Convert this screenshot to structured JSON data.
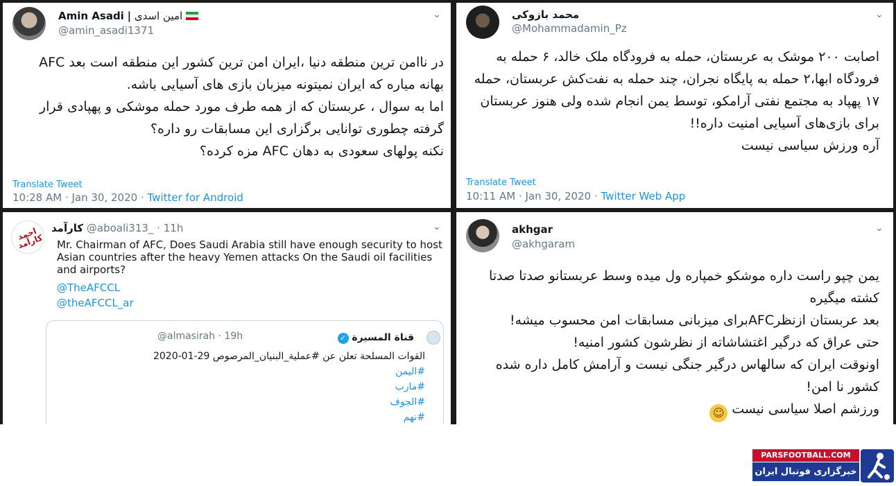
{
  "tweets": [
    {
      "display_name": "Amin Asadi",
      "persian_name": "امین اسدی",
      "handle": "@amin_asadi1371",
      "lines": [
        "در ناامن ترین منطقه دنیا ،ایران امن ترین کشور این منطقه است بعد AFC",
        "بهانه میاره که ایران نمیتونه میزبان بازی های آسیایی باشه.",
        "اما به سوال ، عربستان که از همه طرف مورد حمله موشکی و پهپادی قرار",
        "گرفته چطوری توانایی برگزاری این مسابقات رو داره؟",
        "نکنه پولهای سعودی به دهان AFC مزه کرده؟"
      ],
      "translate": "Translate Tweet",
      "meta": "10:28 AM · Jan 30, 2020 · ",
      "source": "Twitter for Android"
    },
    {
      "display_name": "محمد بازوکی",
      "handle": "@Mohammadamin_Pz",
      "lines": [
        "اصابت ۲۰۰ موشک به عربستان، حمله به فرودگاه ملک خالد، ۶ حمله به",
        "فرودگاه ابها،۲ حمله به پایگاه نجران، چند حمله به نفت‌کش عربستان، حمله",
        "۱۷ پهپاد به مجتمع نفتی آرامکو، توسط یمن انجام شده ولی هنوز عربستان",
        "برای بازی‌های آسیایی امنیت داره!!",
        "آره ورزش سیاسی نیست"
      ],
      "translate": "Translate Tweet",
      "meta": "10:11 AM · Jan 30, 2020 · ",
      "source": "Twitter Web App"
    },
    {
      "display_name": "کارآمد",
      "handle": "@aboali313_ · 11h",
      "avatar_text": "احمد کارآمد",
      "text": "Mr. Chairman of AFC, Does Saudi Arabia still have enough security to host Asian countries after the heavy Yemen attacks On the Saudi oil facilities and airports?",
      "mentions": [
        "@TheAFCCL",
        "@theAFCCL_ar"
      ],
      "quote": {
        "name": "قناة المسيرة",
        "handle": "@almasirah · 19h",
        "lines": [
          "القوات المسلحة تعلن عن #عملية_البنيان_المرصوص 29-01-2020",
          "#اليمن",
          "#مارب",
          "#الجوف",
          "#نهم"
        ]
      }
    },
    {
      "display_name": "akhgar",
      "handle": "@akhgaram",
      "lines": [
        "یمن چپو راست داره موشکو خمپاره ول میده وسط عربستانو صدتا صدتا",
        "کشته میگیره",
        "بعد عربستان ازنظرAFCبرای میزبانی مسابقات امن محسوب میشه!",
        "حتی عراق که درگیر اغتشاشاته از نظرشون کشور امنیه!",
        "اونوقت ایران که سالهاس درگیر جنگی نیست و آرامش کامل داره شده",
        "کشور نا امن!",
        "ورزشم اصلا سیاسی نیست"
      ]
    }
  ],
  "icons": {
    "caret": "chevron-down-icon",
    "verified": "verified-badge-icon",
    "flag": "iran-flag-icon",
    "emoji": "smiley-emoji-icon"
  },
  "colors": {
    "link": "#1b95e0",
    "muted": "#657786",
    "brand_red": "#c8102e",
    "brand_blue": "#1f3a93"
  },
  "branding": {
    "site": "PARSFOOTBALL.COM",
    "tagline": "خبرگزاری فوتبال ایران"
  }
}
